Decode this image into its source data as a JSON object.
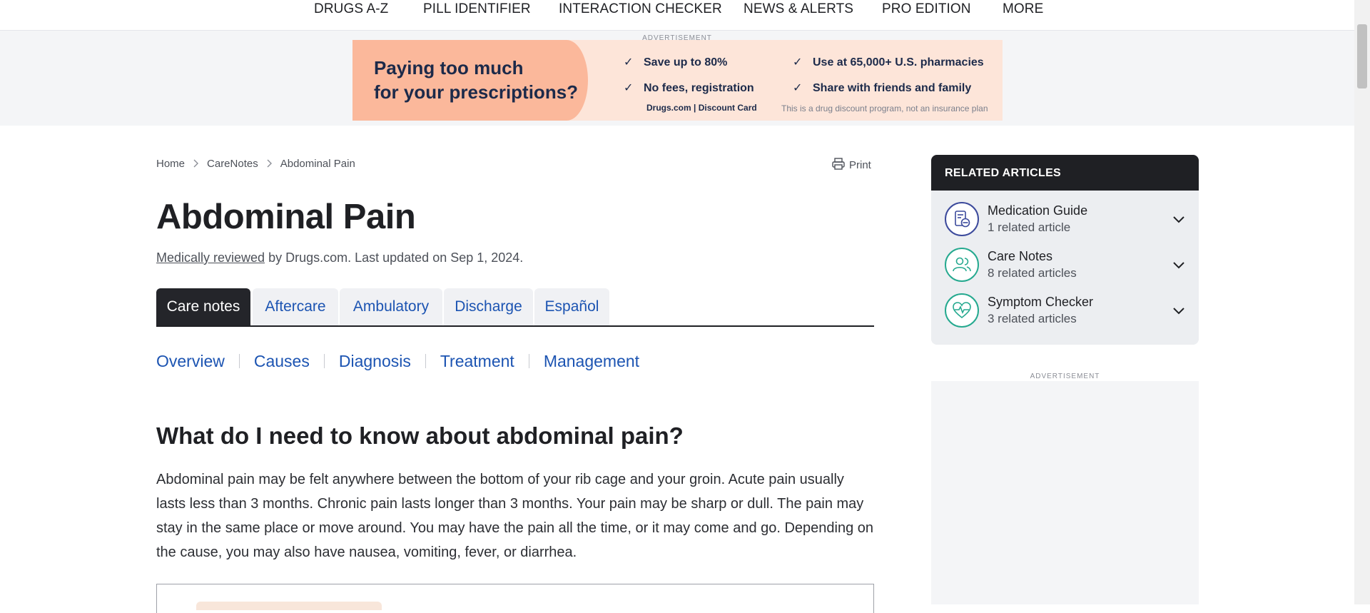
{
  "nav": {
    "items": [
      "DRUGS A-Z",
      "PILL IDENTIFIER",
      "INTERACTION CHECKER",
      "NEWS & ALERTS",
      "PRO EDITION",
      "MORE"
    ]
  },
  "ad_top": {
    "label": "ADVERTISEMENT",
    "headline_line1": "Paying too much",
    "headline_line2": "for your prescriptions?",
    "bullets": [
      "Save up to 80%",
      "Use at 65,000+ U.S. pharmacies",
      "No fees, registration",
      "Share with friends and family"
    ],
    "brand": "Drugs.com | Discount Card",
    "disclaimer": "This is a drug discount program, not an insurance plan"
  },
  "breadcrumb": [
    "Home",
    "CareNotes",
    "Abdominal Pain"
  ],
  "print_label": "Print",
  "page_title": "Abdominal Pain",
  "review": {
    "link": "Medically reviewed",
    "rest": " by Drugs.com. Last updated on Sep 1, 2024."
  },
  "tabs": [
    "Care notes",
    "Aftercare",
    "Ambulatory",
    "Discharge",
    "Español"
  ],
  "active_tab": "Care notes",
  "section_nav": [
    "Overview",
    "Causes",
    "Diagnosis",
    "Treatment",
    "Management"
  ],
  "content": {
    "heading": "What do I need to know about abdominal pain?",
    "paragraph": "Abdominal pain may be felt anywhere between the bottom of your rib cage and your groin. Acute pain usually lasts less than 3 months. Chronic pain lasts longer than 3 months. Your pain may be sharp or dull. The pain may stay in the same place or move around. You may have the pain all the time, or it may come and go. Depending on the cause, you may also have nausea, vomiting, fever, or diarrhea."
  },
  "related": {
    "heading": "RELATED ARTICLES",
    "items": [
      {
        "title": "Medication Guide",
        "count": "1 related article",
        "icon": "medication-guide-icon"
      },
      {
        "title": "Care Notes",
        "count": "8 related articles",
        "icon": "people-icon"
      },
      {
        "title": "Symptom Checker",
        "count": "3 related articles",
        "icon": "heart-pulse-icon"
      }
    ]
  },
  "side_ad_label": "ADVERTISEMENT",
  "colors": {
    "link_blue": "#1c54b2",
    "dark": "#24252a",
    "ad_peach": "#fbb89b",
    "teal": "#25a98f",
    "indigo": "#3c4a9c"
  }
}
